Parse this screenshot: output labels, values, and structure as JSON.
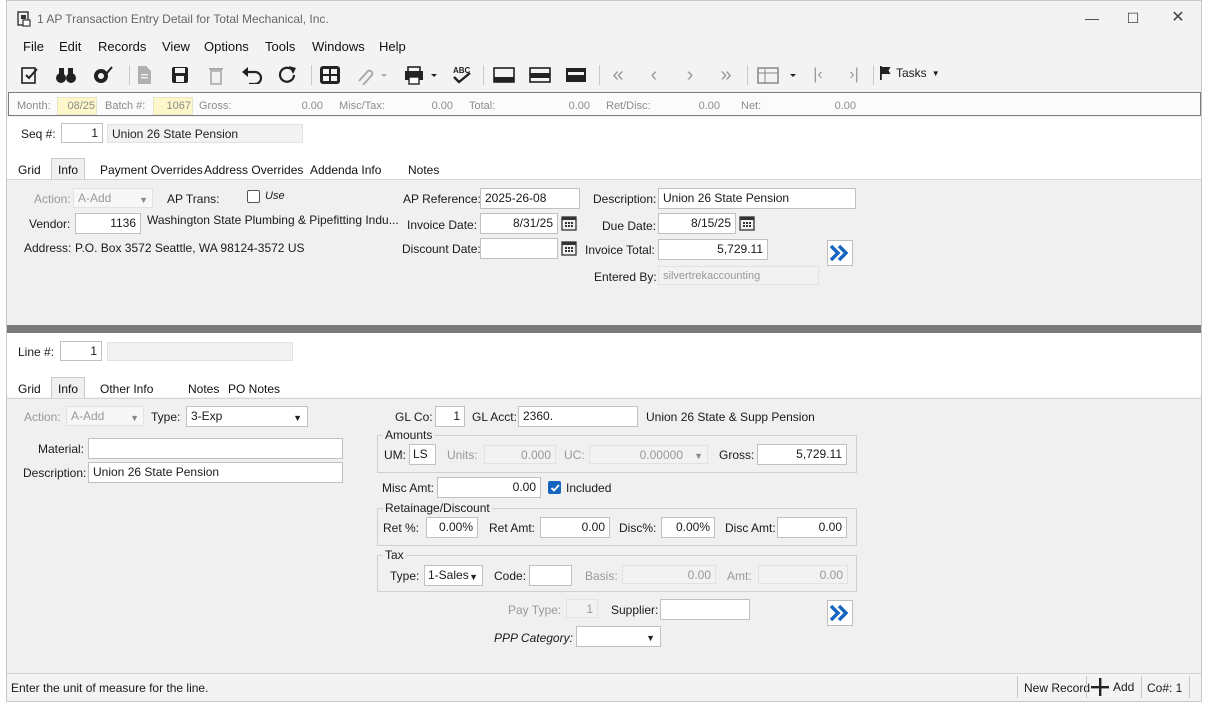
{
  "window": {
    "title": "1 AP Transaction Entry Detail for Total Mechanical, Inc."
  },
  "menu": [
    "File",
    "Edit",
    "Records",
    "View",
    "Options",
    "Tools",
    "Windows",
    "Help"
  ],
  "toolbar": {
    "tasks_label": "Tasks"
  },
  "batch": {
    "month_label": "Month:",
    "month": "08/25",
    "batch_label": "Batch #:",
    "batch": "1067",
    "gross_label": "Gross:",
    "gross": "0.00",
    "misc_label": "Misc/Tax:",
    "misc": "0.00",
    "total_label": "Total:",
    "total": "0.00",
    "retdisc_label": "Ret/Disc:",
    "retdisc": "0.00",
    "net_label": "Net:",
    "net": "0.00"
  },
  "header": {
    "seq_label": "Seq #:",
    "seq": "1",
    "seq_desc": "Union 26 State Pension",
    "tabs": [
      "Grid",
      "Info",
      "Payment Overrides",
      "Address Overrides",
      "Addenda Info",
      "Notes"
    ],
    "action_label": "Action:",
    "action": "A-Add",
    "aptrans_label": "AP Trans:",
    "use_label": "Use",
    "vendor_label": "Vendor:",
    "vendor": "1136",
    "vendor_name": "Washington State Plumbing & Pipefitting Indu...",
    "address_label": "Address:",
    "address": "P.O. Box 3572  Seattle, WA  98124-3572  US",
    "apref_label": "AP Reference:",
    "apref": "2025-26-08",
    "invdate_label": "Invoice Date:",
    "invdate": "8/31/25",
    "discdate_label": "Discount Date:",
    "discdate": "",
    "desc_label": "Description:",
    "desc": "Union 26 State Pension",
    "duedate_label": "Due Date:",
    "duedate": "8/15/25",
    "invtotal_label": "Invoice Total:",
    "invtotal": "5,729.11",
    "enteredby_label": "Entered By:",
    "enteredby": "silvertrekaccounting"
  },
  "line": {
    "line_label": "Line #:",
    "line": "1",
    "tabs": [
      "Grid",
      "Info",
      "Other Info",
      "Notes",
      "PO Notes"
    ],
    "action_label": "Action:",
    "action": "A-Add",
    "type_label": "Type:",
    "type": "3-Exp",
    "material_label": "Material:",
    "material": "",
    "desc_label": "Description:",
    "desc": "Union 26 State Pension",
    "glco_label": "GL Co:",
    "glco": "1",
    "glacct_label": "GL Acct:",
    "glacct": "2360.",
    "glacct_desc": "Union 26 State & Supp Pension",
    "amounts_title": "Amounts",
    "um_label": "UM:",
    "um": "LS",
    "units_label": "Units:",
    "units": "0.000",
    "uc_label": "UC:",
    "uc": "0.00000",
    "gross_label": "Gross:",
    "gross": "5,729.11",
    "misc_label": "Misc Amt:",
    "misc": "0.00",
    "included_label": "Included",
    "ret_title": "Retainage/Discount",
    "retpct_label": "Ret %:",
    "retpct": "0.00%",
    "retamt_label": "Ret Amt:",
    "retamt": "0.00",
    "discpct_label": "Disc%:",
    "discpct": "0.00%",
    "discamt_label": "Disc Amt:",
    "discamt": "0.00",
    "tax_title": "Tax",
    "taxtype_label": "Type:",
    "taxtype": "1-Sales",
    "code_label": "Code:",
    "code": "",
    "basis_label": "Basis:",
    "basis": "0.00",
    "amt_label": "Amt:",
    "amt": "0.00",
    "paytype_label": "Pay Type:",
    "paytype": "1",
    "supplier_label": "Supplier:",
    "supplier": "",
    "ppp_label": "PPP Category:",
    "ppp": ""
  },
  "status": {
    "message": "Enter the unit of measure for the line.",
    "new_record": "New Record",
    "add": "Add",
    "co": "Co#: 1"
  }
}
